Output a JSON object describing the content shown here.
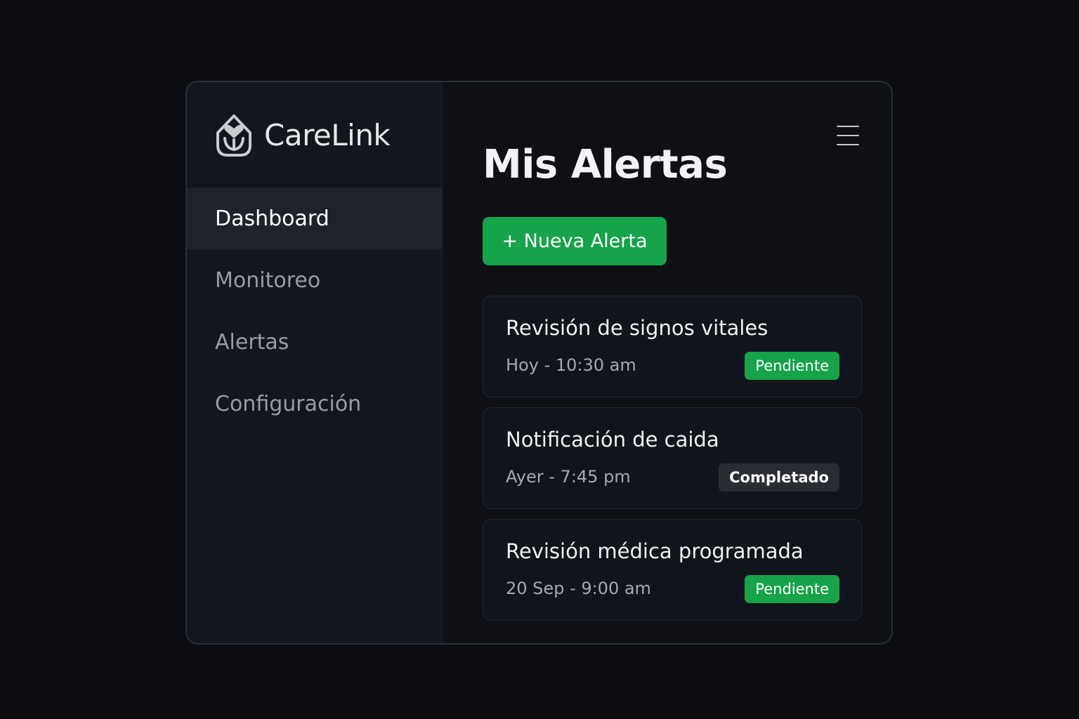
{
  "app": {
    "name": "CareLink",
    "logo_icon": "house-heart-icon"
  },
  "sidebar": {
    "items": [
      {
        "label": "Dashboard",
        "active": true
      },
      {
        "label": "Monitoreo",
        "active": false
      },
      {
        "label": "Alertas",
        "active": false
      },
      {
        "label": "Configuración",
        "active": false
      }
    ]
  },
  "main": {
    "title": "Mis Alertas",
    "menu_icon": "hamburger-menu-icon",
    "new_alert_label": "+ Nueva Alerta",
    "alerts": [
      {
        "title": "Revisión de signos vitales",
        "time": "Hoy - 10:30 am",
        "status": "Pendiente",
        "status_type": "pending"
      },
      {
        "title": "Notificación de caida",
        "time": "Ayer - 7:45 pm",
        "status": "Completado",
        "status_type": "done"
      },
      {
        "title": "Revisión médica programada",
        "time": "20 Sep - 9:00 am",
        "status": "Pendiente",
        "status_type": "pending"
      }
    ]
  },
  "colors": {
    "accent": "#16a34a",
    "background": "#0b0d12",
    "sidebar": "#14161d",
    "card": "#12141b"
  }
}
